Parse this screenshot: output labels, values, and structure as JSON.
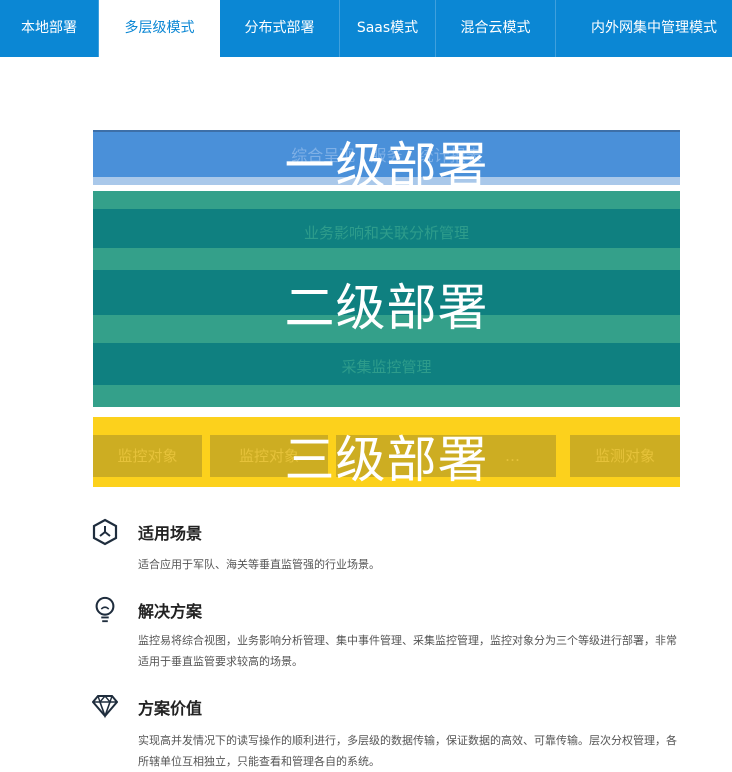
{
  "tabs": [
    {
      "label": "本地部署"
    },
    {
      "label": "多层级模式",
      "active": true
    },
    {
      "label": "分布式部署"
    },
    {
      "label": "Saas模式"
    },
    {
      "label": "混合云模式"
    },
    {
      "label": "内外网集中管理模式"
    }
  ],
  "diagram": {
    "level1": {
      "overlay": "一级部署",
      "text": "综合呈现 · 服务 · 统计报表"
    },
    "level2": {
      "overlay": "二级部署",
      "top_text": "业务影响和关联分析管理",
      "bottom_text": "采集监控管理"
    },
    "level3": {
      "overlay": "三级部署",
      "boxes": [
        "监控对象",
        "监控对象",
        "…",
        "监测对象"
      ]
    }
  },
  "sections": [
    {
      "icon": "scenario-icon",
      "title": "适用场景",
      "body": "适合应用于军队、海关等垂直监管强的行业场景。"
    },
    {
      "icon": "lightbulb-icon",
      "title": "解决方案",
      "body": "监控易将综合视图，业务影响分析管理、集中事件管理、采集监控管理，监控对象分为三个等级进行部署，非常适用于垂直监管要求较高的场景。"
    },
    {
      "icon": "diamond-icon",
      "title": "方案价值",
      "body": "实现高并发情况下的读写操作的顺利进行，多层级的数据传输，保证数据的高效、可靠传输。层次分权管理，各所辖单位互相独立，只能查看和管理各自的系统。"
    }
  ],
  "colors": {
    "tab_bar": "#0b87d4",
    "level1": "#4a90d9",
    "level2": "#0f8080",
    "level3": "#fcd11c"
  }
}
